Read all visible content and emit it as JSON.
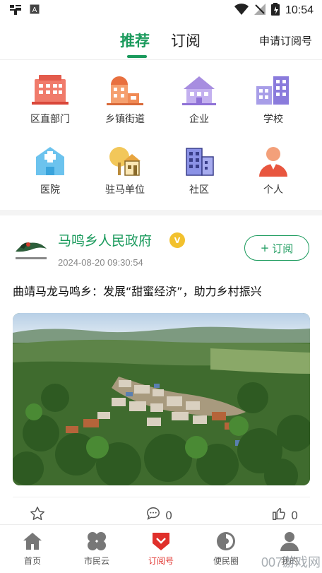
{
  "status_bar": {
    "left_icons": [
      "app-notification-icon",
      "a-badge-icon"
    ],
    "time": "10:54",
    "right_icons": [
      "wifi-icon",
      "no-signal-icon",
      "battery-icon"
    ]
  },
  "header": {
    "tabs": [
      {
        "label": "推荐",
        "active": true
      },
      {
        "label": "订阅",
        "active": false
      }
    ],
    "apply_link": "申请订阅号",
    "accent_color": "#1a9a5c"
  },
  "categories": [
    {
      "label": "区直部门",
      "icon": "office-building-icon"
    },
    {
      "label": "乡镇街道",
      "icon": "township-icon"
    },
    {
      "label": "企业",
      "icon": "enterprise-icon"
    },
    {
      "label": "学校",
      "icon": "school-icon"
    },
    {
      "label": "医院",
      "icon": "hospital-icon"
    },
    {
      "label": "驻马单位",
      "icon": "unit-icon"
    },
    {
      "label": "社区",
      "icon": "community-icon"
    },
    {
      "label": "个人",
      "icon": "person-icon"
    }
  ],
  "post": {
    "author": "马鸣乡人民政府",
    "badge": "V",
    "time": "2024-08-20 09:30:54",
    "subscribe_label": "订阅",
    "title": "曲靖马龙马鸣乡：发展“甜蜜经济”，助力乡村振兴",
    "image": "aerial-village-photo",
    "likes": "0",
    "comments": "0"
  },
  "bottom_nav": [
    {
      "label": "首页",
      "icon": "home-icon",
      "active": false
    },
    {
      "label": "市民云",
      "icon": "clover-icon",
      "active": false
    },
    {
      "label": "订阅号",
      "icon": "subscription-icon",
      "active": true
    },
    {
      "label": "便民圈",
      "icon": "circle-icon",
      "active": false
    },
    {
      "label": "我的",
      "icon": "profile-icon",
      "active": false
    }
  ],
  "watermark": "007游戏网"
}
